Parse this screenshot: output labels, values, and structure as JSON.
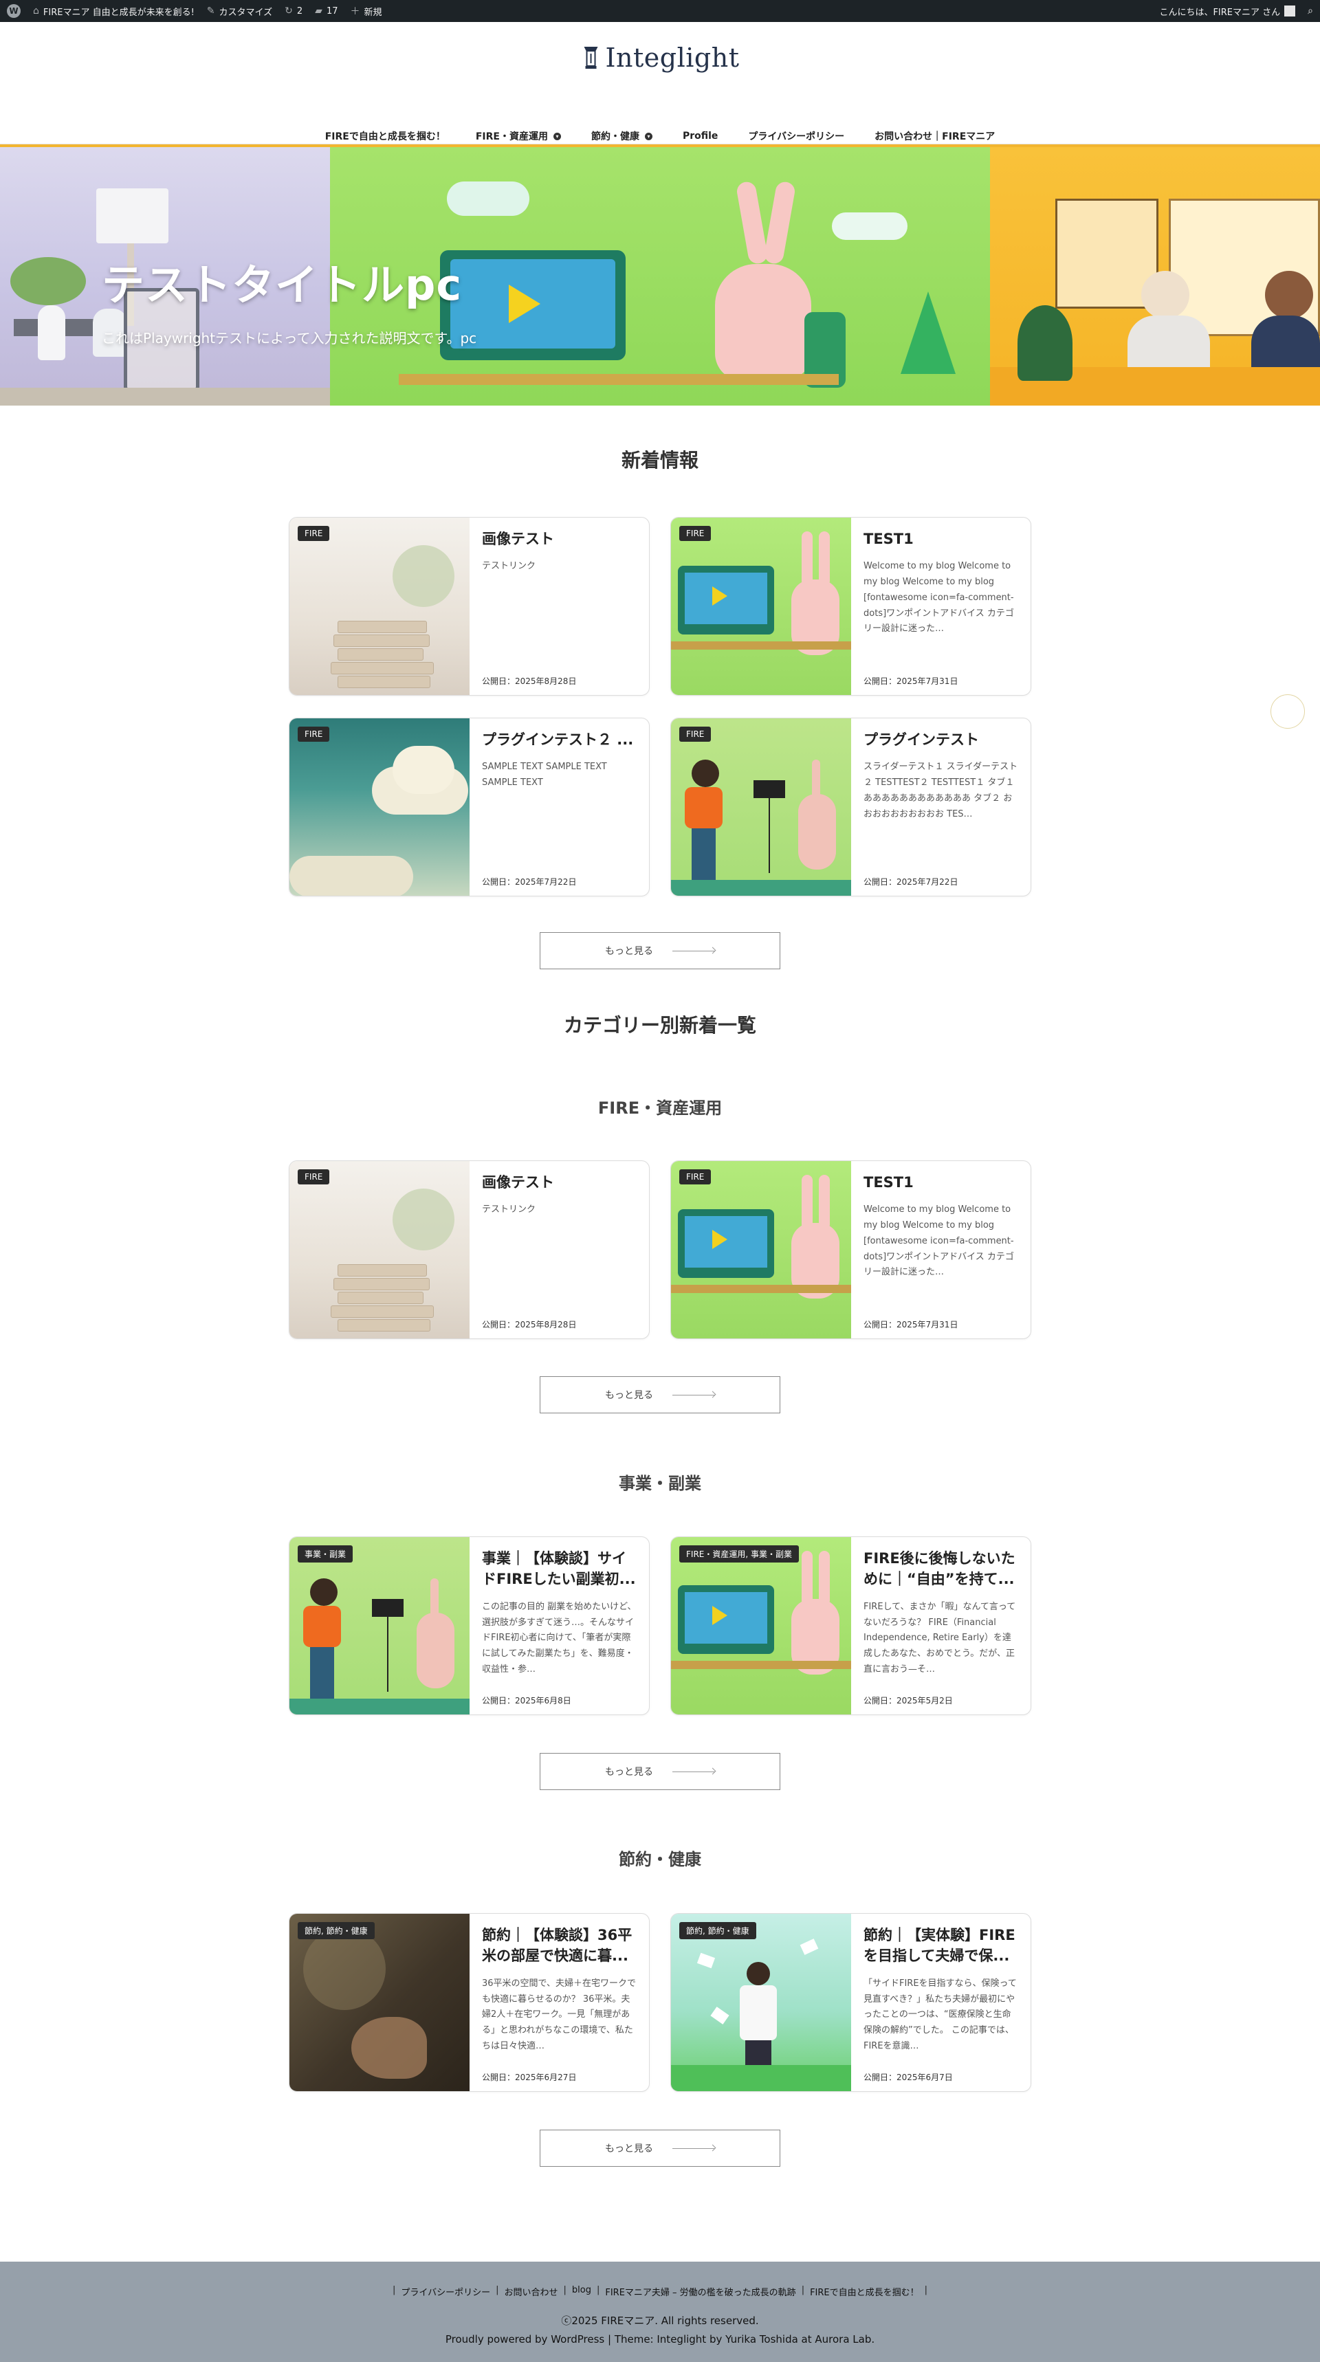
{
  "admin_bar": {
    "site_name": "FIREマニア 自由と成長が未来を創る!",
    "customize": "カスタマイズ",
    "updates_count": "2",
    "comments_count": "17",
    "new_label": "新規",
    "greeting": "こんにちは、FIREマニア さん"
  },
  "header": {
    "logo_text": "Integlight",
    "nav": [
      {
        "label": "FIREで自由と成長を掴む！",
        "has_submenu": false
      },
      {
        "label": "FIRE・資産運用",
        "has_submenu": true
      },
      {
        "label": "節約・健康",
        "has_submenu": true
      },
      {
        "label": "Profile",
        "has_submenu": false
      },
      {
        "label": "プライバシーポリシー",
        "has_submenu": false
      },
      {
        "label": "お問い合わせ｜FIREマニア",
        "has_submenu": false
      }
    ]
  },
  "hero": {
    "title": "テストタイトルpc",
    "description": "これはPlaywrightテストによって入力された説明文です。pc"
  },
  "latest": {
    "heading": "新着情報",
    "more_label": "もっと見る",
    "cards": [
      {
        "badge": "FIRE",
        "title": "画像テスト",
        "excerpt": "テストリンク",
        "date": "公開日：2025年8月28日"
      },
      {
        "badge": "FIRE",
        "title": "TEST1",
        "excerpt": "Welcome to my blog Welcome to my blog Welcome to my blog [fontawesome icon=fa-comment-dots]ワンポイントアドバイス カテゴリー設計に迷った…",
        "date": "公開日：2025年7月31日"
      },
      {
        "badge": "FIRE",
        "title": "プラグインテスト２ ...",
        "excerpt": "SAMPLE TEXT SAMPLE TEXT SAMPLE TEXT",
        "date": "公開日：2025年7月22日"
      },
      {
        "badge": "FIRE",
        "title": "プラグインテスト",
        "excerpt": "スライダーテスト１ スライダーテスト２ TESTTEST２ TESTTEST１ タブ１ ああああああああああああ タブ２ おおおおおおおおおお TES…",
        "date": "公開日：2025年7月22日"
      }
    ]
  },
  "category_heading": "カテゴリー別新着一覧",
  "categories": [
    {
      "heading": "FIRE・資産運用",
      "more_label": "もっと見る",
      "cards": [
        {
          "badge": "FIRE",
          "title": "画像テスト",
          "excerpt": "テストリンク",
          "date": "公開日：2025年8月28日"
        },
        {
          "badge": "FIRE",
          "title": "TEST1",
          "excerpt": "Welcome to my blog Welcome to my blog Welcome to my blog [fontawesome icon=fa-comment-dots]ワンポイントアドバイス カテゴリー設計に迷った…",
          "date": "公開日：2025年7月31日"
        }
      ]
    },
    {
      "heading": "事業・副業",
      "more_label": "もっと見る",
      "cards": [
        {
          "badge": "事業・副業",
          "title": "事業｜【体験談】サイドFIREしたい副業初...",
          "excerpt": "この記事の目的 副業を始めたいけど、選択肢が多すぎて迷う…。そんなサイドFIRE初心者に向けて、「筆者が実際に試してみた副業たち」を、難易度・収益性・参…",
          "date": "公開日：2025年6月8日"
        },
        {
          "badge": "FIRE・資産運用, 事業・副業",
          "title": "FIRE後に後悔しないために｜“自由”を持て...",
          "excerpt": "FIREして、まさか「暇」なんて言ってないだろうな？ FIRE（Financial Independence, Retire Early）を達成したあなた、おめでとう。だが、正直に言おう—そ…",
          "date": "公開日：2025年5月2日"
        }
      ]
    },
    {
      "heading": "節約・健康",
      "more_label": "もっと見る",
      "cards": [
        {
          "badge": "節約, 節約・健康",
          "title": "節約｜【体験談】36平米の部屋で快適に暮...",
          "excerpt": "36平米の空間で、夫婦＋在宅ワークでも快適に暮らせるのか？ 36平米。夫婦2人＋在宅ワーク。一見「無理がある」と思われがちなこの環境で、私たちは日々快適…",
          "date": "公開日：2025年6月27日"
        },
        {
          "badge": "節約, 節約・健康",
          "title": "節約｜【実体験】FIREを目指して夫婦で保...",
          "excerpt": "「サイドFIREを目指すなら、保険って見直すべき？」私たち夫婦が最初にやったことの一つは、“医療保険と生命保険の解約”でした。 この記事では、FIREを意識…",
          "date": "公開日：2025年6月7日"
        }
      ]
    }
  ],
  "footer": {
    "links": [
      "プライバシーポリシー",
      "お問い合わせ",
      "blog",
      "FIREマニア夫婦 – 労働の檻を破った成長の軌跡",
      "FIREで自由と成長を掴む！"
    ],
    "copyright": "ⓒ2025 FIREマニア. All rights reserved.",
    "powered": "Proudly powered by WordPress | Theme: Integlight by Yurika Toshida at Aurora Lab."
  }
}
